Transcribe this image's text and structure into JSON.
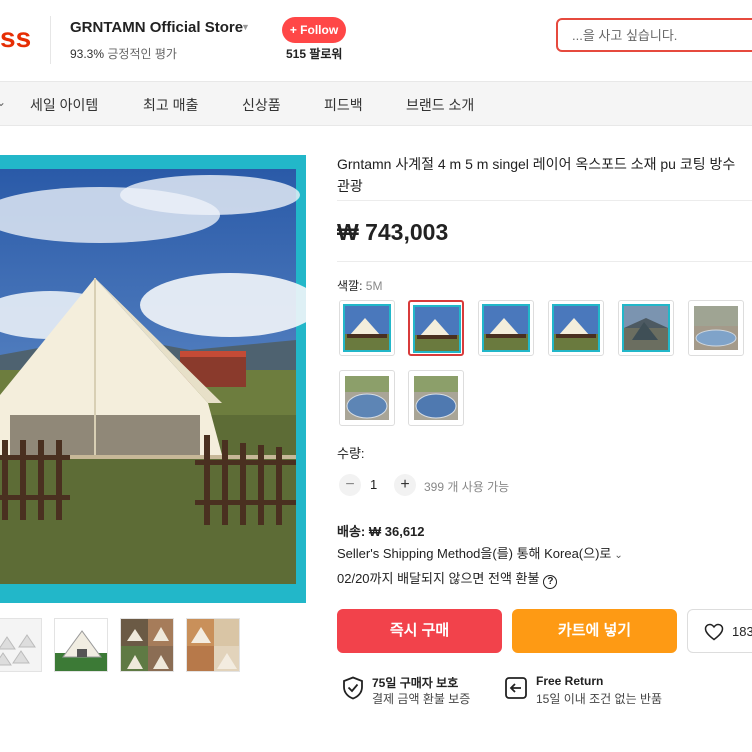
{
  "header": {
    "logo_text": "ss",
    "store_name": "GRNTAMN Official Store",
    "rating_value": "93.3%",
    "rating_label": "긍정적인 평가",
    "follow_label": "+ Follow",
    "followers": "515 팔로워",
    "search_placeholder": "...을 사고 싶습니다."
  },
  "nav": {
    "items": [
      {
        "label": "세일 아이템"
      },
      {
        "label": "최고 매출"
      },
      {
        "label": "신상품"
      },
      {
        "label": "피드백"
      },
      {
        "label": "브랜드 소개"
      }
    ]
  },
  "product": {
    "title_line1": "Grntamn 사계절 4 m 5 m singel 레이어 옥스포드 소재 pu 코팅 방수",
    "title_line2": "관광",
    "price": "₩ 743,003",
    "color_label": "색깔:",
    "color_value": "5M",
    "quantity_label": "수량:",
    "quantity_value": "1",
    "quantity_minus": "−",
    "quantity_plus": "+",
    "available": "399 개 사용 가능",
    "shipping_price": "배송: ₩ 36,612",
    "shipping_method": "Seller's Shipping Method을(를) 통해 Korea(으)로",
    "shipping_note": "02/20까지 배달되지 않으면 전액 환불",
    "shipping_note_icon": "?"
  },
  "actions": {
    "buy_now": "즉시 구매",
    "add_to_cart": "카트에 넣기",
    "wishlist_count": "183"
  },
  "promises": [
    {
      "title": "75일 구매자 보호",
      "subtitle": "결제 금액 환불 보증",
      "icon": "shield-check-icon"
    },
    {
      "title": "Free Return",
      "subtitle": "15일 이내 조건 없는 반품",
      "icon": "return-icon"
    }
  ],
  "colors": {
    "accent_red": "#f2424b",
    "accent_orange": "#fe9a14",
    "image_border": "#22b7c9"
  }
}
